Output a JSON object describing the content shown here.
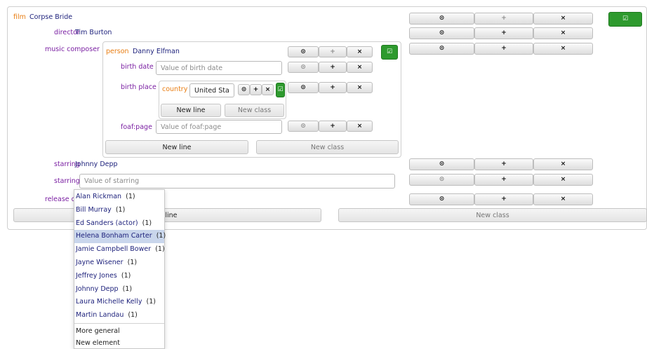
{
  "film": {
    "class_label": "film",
    "value": "Corpse Bride"
  },
  "rows": {
    "director": {
      "label": "director",
      "value": "Tim Burton"
    },
    "music_composer": {
      "label": "music composer"
    },
    "starring1": {
      "label": "starring",
      "value": "Johnny Depp"
    },
    "starring2": {
      "label": "starring",
      "placeholder": "Value of starring"
    },
    "release": {
      "label": "release d"
    }
  },
  "person": {
    "class_label": "person",
    "value": "Danny Elfman",
    "birth_date": {
      "label": "birth date",
      "placeholder": "Value of birth date"
    },
    "birth_place": {
      "label": "birth place"
    },
    "foaf_page": {
      "label": "foaf:page",
      "placeholder": "Value of foaf:page"
    },
    "new_line": "New line",
    "new_class": "New class"
  },
  "country": {
    "class_label": "country",
    "value": "United State",
    "new_line": "New line",
    "new_class": "New class"
  },
  "outer": {
    "new_line_visible": "w line",
    "new_class": "New class"
  },
  "icons": {
    "select": "⊙",
    "add": "+",
    "remove": "×",
    "confirm": "☑"
  },
  "colors": {
    "class": "#e87d12",
    "property": "#7a1fa2",
    "value": "#1b1f7a",
    "confirm": "#2e9a2e",
    "highlight": "#c9d6ec"
  },
  "dropdown": {
    "items": [
      {
        "name": "Alan Rickman",
        "count": "(1)"
      },
      {
        "name": "Bill Murray",
        "count": "(1)"
      },
      {
        "name": "Ed Sanders (actor)",
        "count": "(1)"
      },
      {
        "name": "Helena Bonham Carter",
        "count": "(1)"
      },
      {
        "name": "Jamie Campbell Bower",
        "count": "(1)"
      },
      {
        "name": "Jayne Wisener",
        "count": "(1)"
      },
      {
        "name": "Jeffrey Jones",
        "count": "(1)"
      },
      {
        "name": "Johnny Depp",
        "count": "(1)"
      },
      {
        "name": "Laura Michelle Kelly",
        "count": "(1)"
      },
      {
        "name": "Martin Landau",
        "count": "(1)"
      }
    ],
    "highlighted_index": 3,
    "commands": [
      "More general",
      "New element"
    ]
  }
}
